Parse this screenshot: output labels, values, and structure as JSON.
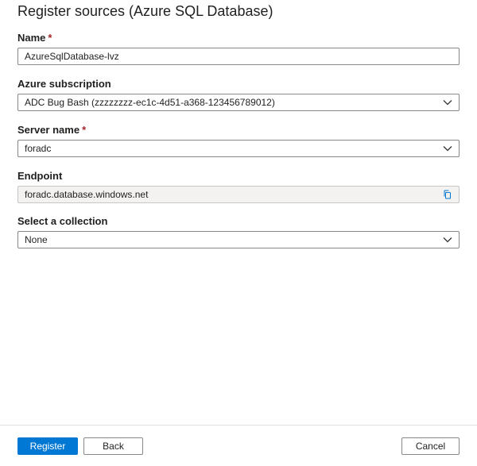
{
  "panel": {
    "title": "Register sources (Azure SQL Database)"
  },
  "form": {
    "name": {
      "label": "Name",
      "required_mark": "*",
      "value": "AzureSqlDatabase-lvz"
    },
    "subscription": {
      "label": "Azure subscription",
      "selected": "ADC Bug Bash (zzzzzzzz-ec1c-4d51-a368-123456789012)",
      "icon": "chevron-down-icon"
    },
    "server": {
      "label": "Server name",
      "required_mark": "*",
      "selected": "foradc",
      "icon": "chevron-down-icon"
    },
    "endpoint": {
      "label": "Endpoint",
      "value": "foradc.database.windows.net",
      "icon": "copy-icon"
    },
    "collection": {
      "label": "Select a collection",
      "selected": "None",
      "icon": "chevron-down-icon"
    }
  },
  "footer": {
    "register_label": "Register",
    "back_label": "Back",
    "cancel_label": "Cancel"
  },
  "colors": {
    "primary": "#0078d4",
    "required": "#a4262c",
    "border": "#8a8886",
    "readonly_bg": "#f3f2f1"
  }
}
